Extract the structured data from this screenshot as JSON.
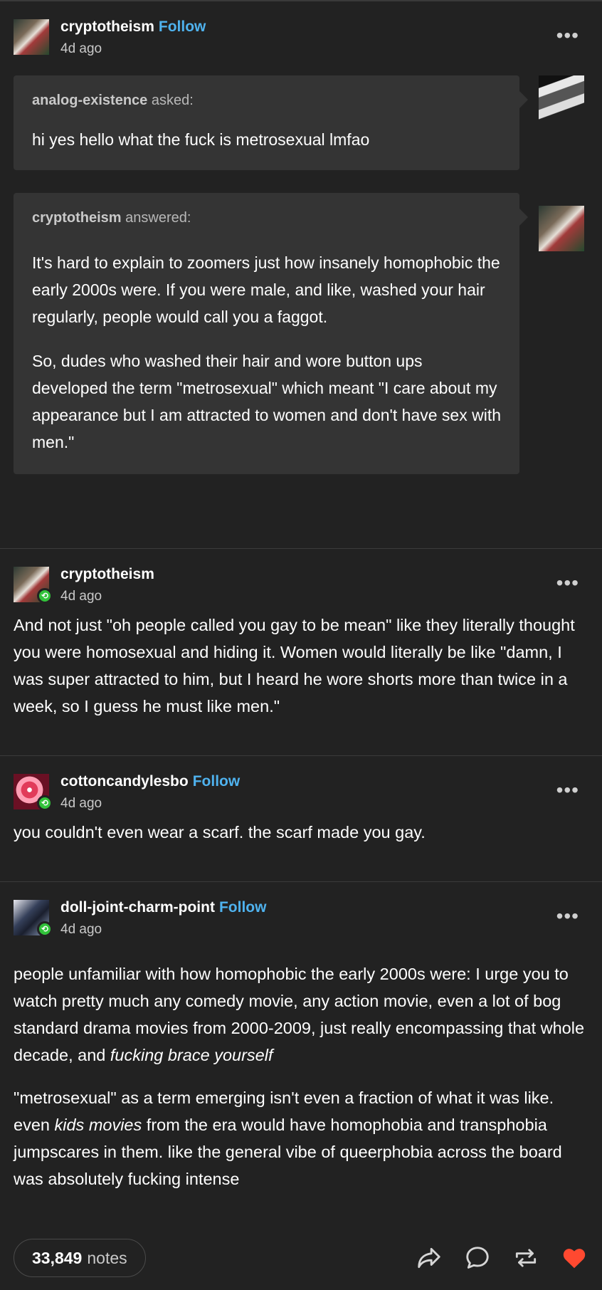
{
  "post1": {
    "username": "cryptotheism",
    "follow_label": "Follow",
    "time": "4d ago",
    "more": "•••",
    "ask": {
      "asker": "analog-existence",
      "verb": "asked:",
      "question": "hi yes hello what the fuck is metrosexual lmfao"
    },
    "answer": {
      "answerer": "cryptotheism",
      "verb": "answered:",
      "paragraphs": [
        "It's hard to explain to zoomers just how insanely homophobic the early 2000s were. If you were male, and like, washed your hair regularly, people would call you a faggot.",
        "So, dudes who washed their hair and wore button ups developed the term \"metrosexual\" which meant \"I care about my appearance but I am attracted to women and don't have sex with men.\""
      ]
    }
  },
  "reblog1": {
    "username": "cryptotheism",
    "time": "4d ago",
    "more": "•••",
    "text": "And not just \"oh people called you gay to be mean\" like they literally thought you were homosexual and hiding it. Women would literally be like \"damn, I was super attracted to him, but I heard he wore shorts more than twice in a week, so I guess he must like men.\""
  },
  "reblog2": {
    "username": "cottoncandylesbo",
    "follow_label": "Follow",
    "time": "4d ago",
    "more": "•••",
    "text": "you couldn't even wear a scarf. the scarf made you gay."
  },
  "reblog3": {
    "username": "doll-joint-charm-point",
    "follow_label": "Follow",
    "time": "4d ago",
    "more": "•••",
    "p1_start": "people unfamiliar with how homophobic the early 2000s were: I urge you to watch pretty much any comedy movie, any action movie, even a lot of bog standard drama movies from 2000-2009, just really encompassing that whole decade, and ",
    "p1_em": "fucking brace yourself",
    "p2_start": "\"metrosexual\" as a term emerging isn't even a fraction of what it was like. even ",
    "p2_em": "kids movies",
    "p2_end": " from the era would have homophobia and transphobia jumpscares in them. like the general vibe of queerphobia across the board was absolutely fucking intense"
  },
  "footer": {
    "notes_count": "33,849",
    "notes_label": "notes",
    "icons": [
      "share-icon",
      "reply-icon",
      "reblog-icon",
      "like-icon"
    ],
    "like_color": "#ff4930"
  }
}
